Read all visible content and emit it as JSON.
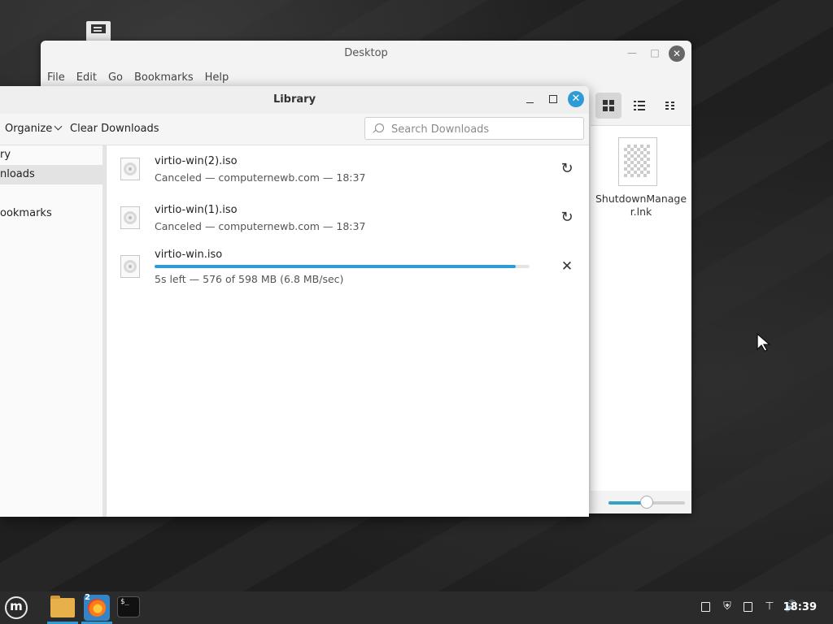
{
  "nemo": {
    "title": "Desktop",
    "menu": [
      "File",
      "Edit",
      "Go",
      "Bookmarks",
      "Help"
    ],
    "file": {
      "name": "ShutdownManager.lnk"
    },
    "zoom_level": 0.5
  },
  "library": {
    "title": "Library",
    "toolbar": {
      "organize_label": "Organize",
      "clear_label": "Clear Downloads",
      "search_placeholder": "Search Downloads"
    },
    "sidebar": [
      {
        "label": "ry",
        "selected": false
      },
      {
        "label": "nloads",
        "selected": true
      },
      {
        "label": "ookmarks",
        "selected": false
      }
    ],
    "downloads": [
      {
        "name": "virtio-win(2).iso",
        "status": "Canceled — computernewb.com — 18:37",
        "action_icon": "retry-icon"
      },
      {
        "name": "virtio-win(1).iso",
        "status": "Canceled — computernewb.com — 18:37",
        "action_icon": "retry-icon"
      },
      {
        "name": "virtio-win.iso",
        "status": "5s left — 576 of 598 MB (6.8 MB/sec)",
        "action_icon": "cancel-icon",
        "progress": 0.963
      }
    ]
  },
  "taskbar": {
    "firefox_badge": "2",
    "terminal_glyph": "$_",
    "clock": "18:39"
  },
  "colors": {
    "accent": "#2e9bd6",
    "folder": "#e8b04a"
  }
}
